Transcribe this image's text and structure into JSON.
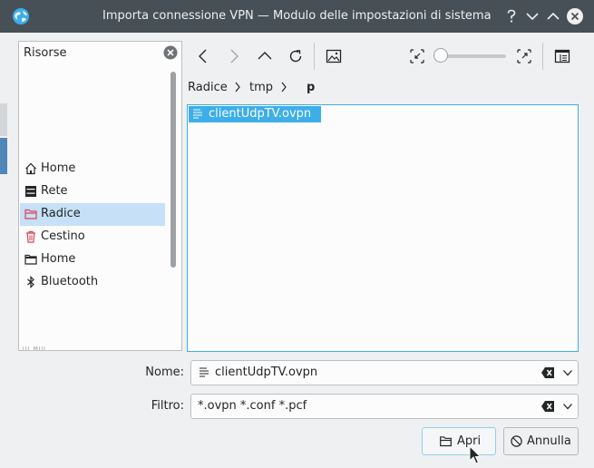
{
  "window": {
    "title": "Importa connessione VPN — Modulo delle impostazioni di sistema"
  },
  "sidebar": {
    "title": "Risorse",
    "cut_text": "ᴵᴵᴵ ᴹᴵᴵᴵ",
    "places": [
      {
        "label": "Home",
        "icon": "home-icon",
        "color": "#232627"
      },
      {
        "label": "Rete",
        "icon": "network-icon",
        "color": "#232627"
      },
      {
        "label": "Radice",
        "icon": "folder-red-icon",
        "color": "#da4453",
        "active": true
      },
      {
        "label": "Cestino",
        "icon": "trash-icon",
        "color": "#da4453"
      },
      {
        "label": "Home",
        "icon": "folder-icon",
        "color": "#232627"
      },
      {
        "label": "Bluetooth",
        "icon": "bluetooth-icon",
        "color": "#232627"
      }
    ]
  },
  "breadcrumb": {
    "items": [
      "Radice",
      "tmp",
      "p"
    ]
  },
  "files": [
    {
      "name": "clientUdpTV.ovpn",
      "icon": "text-file-icon",
      "selected": true
    }
  ],
  "form": {
    "name_label": "Nome:",
    "name_value": "clientUdpTV.ovpn",
    "filter_label": "Filtro:",
    "filter_value": "*.ovpn *.conf *.pcf"
  },
  "buttons": {
    "open_label": "Apri",
    "cancel_label": "Annulla"
  },
  "colors": {
    "titlebar": "#475057",
    "accent": "#3daee9",
    "selection_light": "#c6e0f7",
    "red": "#da4453"
  }
}
